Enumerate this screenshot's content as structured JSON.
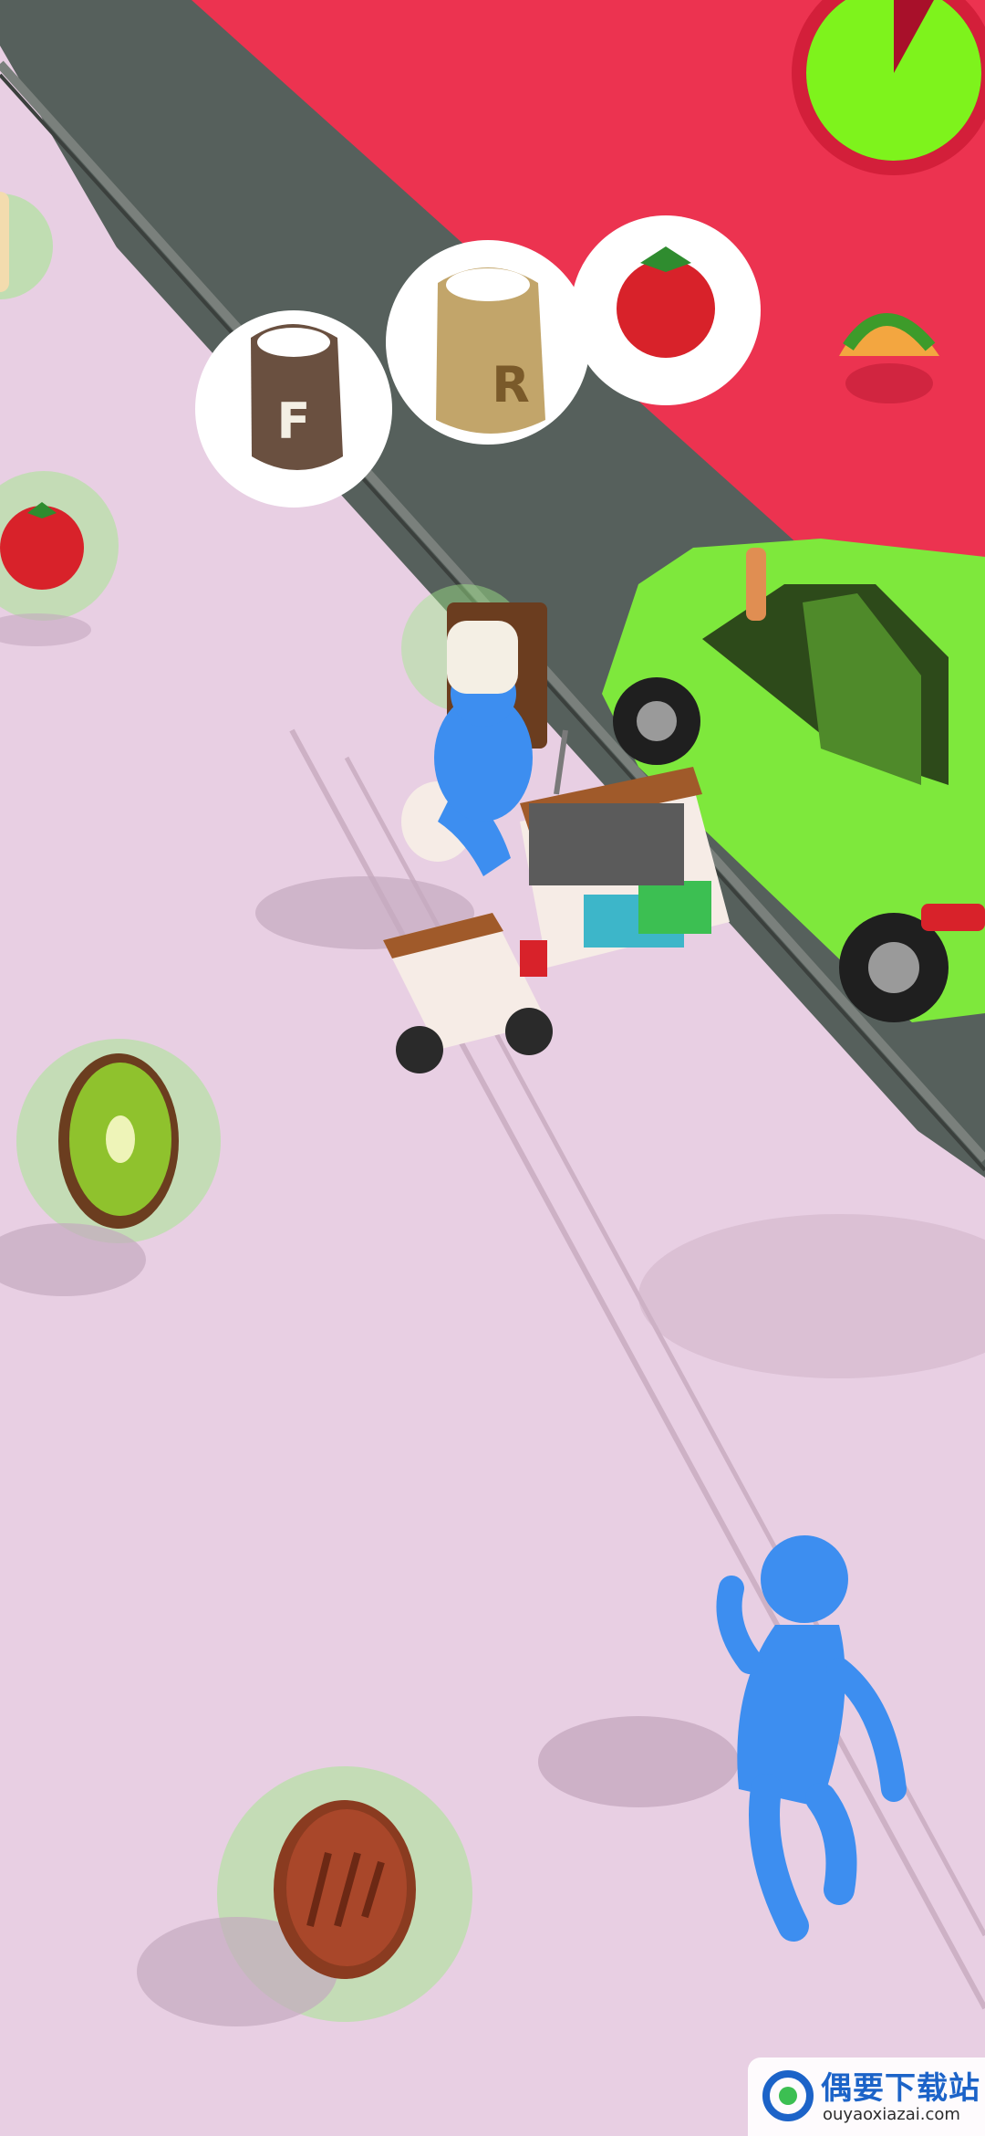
{
  "game": {
    "timer": {
      "progress": 0.92,
      "color": "#7ef31c",
      "ring_color": "#d31f3a"
    },
    "order_bubbles": [
      {
        "icon": "flour-sack-icon",
        "letter": "F"
      },
      {
        "icon": "rice-sack-icon",
        "letter": "R"
      },
      {
        "icon": "tomato-icon",
        "letter": ""
      }
    ],
    "next_order_icon": "taco-icon",
    "pickups": [
      "bread-icon",
      "tomato-icon",
      "kiwi-icon",
      "meat-patty-icon"
    ],
    "colors": {
      "road": "#e8cfe3",
      "shoulder": "#56605c",
      "restaurant_floor": "#ec3350",
      "car": "#7ee83c",
      "character": "#3d8ef0"
    }
  },
  "watermark": {
    "title": "偶要下载站",
    "url": "ouyaoxiazai.com"
  }
}
